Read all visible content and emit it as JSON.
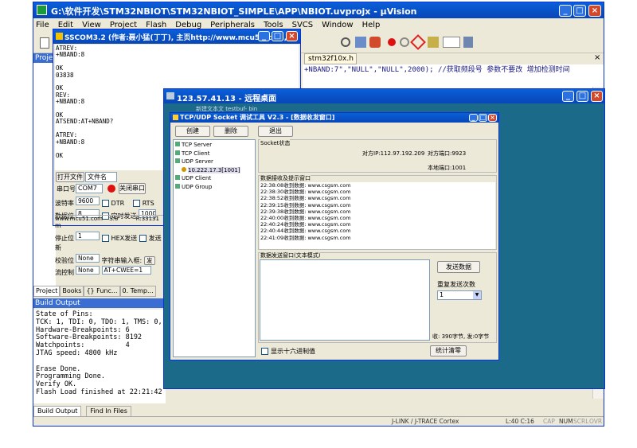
{
  "uvision": {
    "title": "G:\\软件开发\\STM32NBIOT\\STM32NBIOT_SIMPLE\\APP\\NBIOT.uvprojx - µVision",
    "menu": [
      "File",
      "Edit",
      "View",
      "Project",
      "Flash",
      "Debug",
      "Peripherals",
      "Tools",
      "SVCS",
      "Window",
      "Help"
    ],
    "project_label": "Project",
    "editor_tab": "stm32f10x.h",
    "code_line": "+NBAND:7\",\"NULL\",\"NULL\",2000);   //获取频段号 参数不要改 增加检测时间",
    "bottom_tabs": [
      "Project",
      "Books",
      "{} Func...",
      "0. Temp..."
    ],
    "build_output_title": "Build Output",
    "build_output_lines": [
      "State of Pins:",
      "TCK: 1, TDI: 0, TDO: 1, TMS: 0, TRE",
      "Hardware-Breakpoints: 6",
      "Software-Breakpoints: 8192",
      "Watchpoints:          4",
      "JTAG speed: 4800 kHz",
      "",
      "Erase Done.",
      "Programming Done.",
      "Verify OK.",
      "Flash Load finished at 22:21:42"
    ],
    "output_tabs": [
      "Build Output",
      "Find In Files"
    ],
    "status": {
      "debugger": "J-LINK / J-TRACE Cortex",
      "position": "L:40 C:16",
      "caps": "CAP",
      "num": "NUM",
      "scrl": "SCRL",
      "ovr": "OVR"
    }
  },
  "sscom": {
    "title": "SSCOM3.2 (作者:聂小猛(丁丁), 主页http://www.mcu51.com,...",
    "log_lines": [
      "ATREV:",
      "+NBAND:8",
      "",
      "OK",
      "03838",
      "",
      "OK",
      "REV:",
      "+NBAND:8",
      "",
      "OK",
      "ATSEND:AT+NBAND?",
      "",
      "ATREV:",
      "+NBAND:8",
      "",
      "OK"
    ],
    "open_file_btn": "打开文件",
    "file_name_label": "文件名",
    "port_label": "串口号",
    "port_value": "COM7",
    "close_port_btn": "关闭串口",
    "baud_label": "波特率",
    "baud_value": "9600",
    "databits_label": "数据位",
    "databits_value": "8",
    "stopbits_label": "停止位",
    "stopbits_value": "1",
    "parity_label": "校验位",
    "parity_value": "None",
    "flow_label": "流控制",
    "flow_value": "None",
    "dtr": "DTR",
    "rts": "RTS",
    "timed_send": "定时发送",
    "interval_value": "1000",
    "interval_unit": "m",
    "hex_send": "HEX发送",
    "send_newline": "发送新",
    "input_label": "字符串输入框:",
    "send_btn": "发",
    "input_value": "AT+CWEE=1",
    "website": "www.mcu51.com",
    "s_count": "S:0",
    "r_count": "R:33131"
  },
  "remote": {
    "title": "123.57.41.13 - 远程桌面",
    "desktop_text": "新建文本文  testbuf-  bin"
  },
  "tcpudp": {
    "title": "TCP/UDP Socket 调试工具 V2.3 - [数据收发窗口]",
    "create_btn": "创建",
    "delete_btn": "删除",
    "exit_btn": "退出",
    "tree": {
      "tcp_server": "TCP Server",
      "tcp_client": "TCP Client",
      "udp_server": "UDP Server",
      "udp_child": "10.222.17.3[1001]",
      "udp_client": "UDP Client",
      "udp_group": "UDP Group"
    },
    "socket_status_label": "Socket状态",
    "peer_ip": "对方IP:112.97.192.209",
    "peer_port": "对方端口:9923",
    "local_port": "本地端口:1001",
    "recv_title": "数据接收及提示窗口",
    "recv_lines": [
      "22:38:08收到数据: www.csgsm.com",
      "22:38:30收到数据: www.csgsm.com",
      "22:38:52收到数据: www.csgsm.com",
      "22:39:15收到数据: www.csgsm.com",
      "22:39:38收到数据: www.csgsm.com",
      "22:40:00收到数据: www.csgsm.com",
      "22:40:24收到数据: www.csgsm.com",
      "22:40:44收到数据: www.csgsm.com",
      "22:41:09收到数据: www.csgsm.com"
    ],
    "send_title": "数据发送窗口(文本模式)",
    "send_data_btn": "发送数据",
    "repeat_label": "重复发送次数",
    "repeat_value": "1",
    "counts": "收: 390字节, 发:0字节",
    "hex_display": "显示十六进制值",
    "clear_stats_btn": "统计清零"
  }
}
